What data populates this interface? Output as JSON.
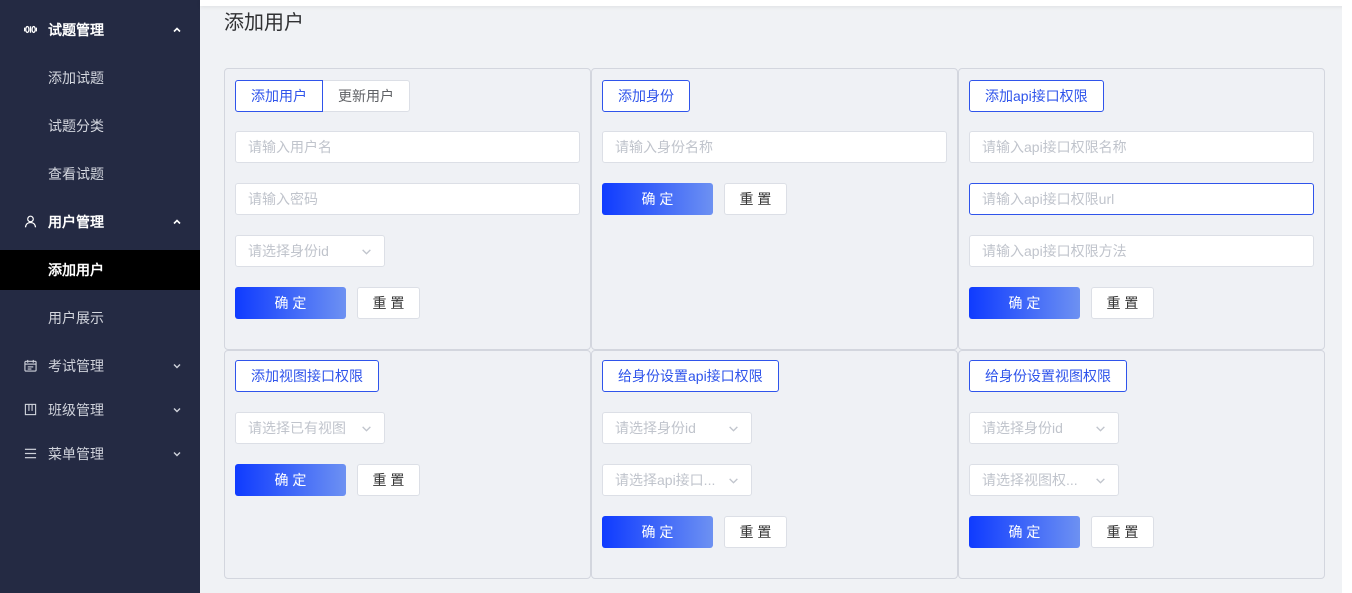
{
  "theme": {
    "sidebar-bg": "#242a43",
    "sidebar-active-bg": "#000000",
    "page-bg": "#f0f2f5",
    "accent": "#2f54eb",
    "confirm-start": "#0f3bff",
    "confirm-end": "#6d91f2"
  },
  "sidebar": {
    "groups": [
      {
        "label": "试题管理",
        "icon": "binary-code-icon",
        "expanded": true,
        "items": [
          {
            "label": "添加试题"
          },
          {
            "label": "试题分类"
          },
          {
            "label": "查看试题"
          }
        ]
      },
      {
        "label": "用户管理",
        "icon": "user-icon",
        "expanded": true,
        "items": [
          {
            "label": "添加用户",
            "active": true
          },
          {
            "label": "用户展示",
            "active": false
          }
        ]
      },
      {
        "label": "考试管理",
        "icon": "calendar-icon",
        "expanded": false
      },
      {
        "label": "班级管理",
        "icon": "columns-icon",
        "expanded": false
      },
      {
        "label": "菜单管理",
        "icon": "menu-icon",
        "expanded": false
      }
    ]
  },
  "page": {
    "title": "添加用户"
  },
  "cards": {
    "add_user": {
      "tabs": [
        {
          "label": "添加用户",
          "active": true
        },
        {
          "label": "更新用户",
          "active": false
        }
      ],
      "username": {
        "placeholder": "请输入用户名",
        "value": ""
      },
      "password": {
        "placeholder": "请输入密码",
        "value": ""
      },
      "role_select": {
        "placeholder": "请选择身份id"
      },
      "confirm": "确 定",
      "reset": "重 置"
    },
    "add_role": {
      "title_button": "添加身份",
      "role_name": {
        "placeholder": "请输入身份名称",
        "value": ""
      },
      "confirm": "确 定",
      "reset": "重 置"
    },
    "add_api_permission": {
      "title_button": "添加api接口权限",
      "name": {
        "placeholder": "请输入api接口权限名称",
        "value": ""
      },
      "url": {
        "placeholder": "请输入api接口权限url",
        "value": "",
        "focused": true
      },
      "method": {
        "placeholder": "请输入api接口权限方法",
        "value": ""
      },
      "confirm": "确 定",
      "reset": "重 置"
    },
    "add_view_permission": {
      "title_button": "添加视图接口权限",
      "view_select": {
        "placeholder": "请选择已有视图"
      },
      "confirm": "确 定",
      "reset": "重 置"
    },
    "set_role_api_permission": {
      "title_button": "给身份设置api接口权限",
      "role_select": {
        "placeholder": "请选择身份id"
      },
      "api_select": {
        "placeholder": "请选择api接口..."
      },
      "confirm": "确 定",
      "reset": "重 置"
    },
    "set_role_view_permission": {
      "title_button": "给身份设置视图权限",
      "role_select": {
        "placeholder": "请选择身份id"
      },
      "view_select": {
        "placeholder": "请选择视图权..."
      },
      "confirm": "确 定",
      "reset": "重 置"
    }
  }
}
